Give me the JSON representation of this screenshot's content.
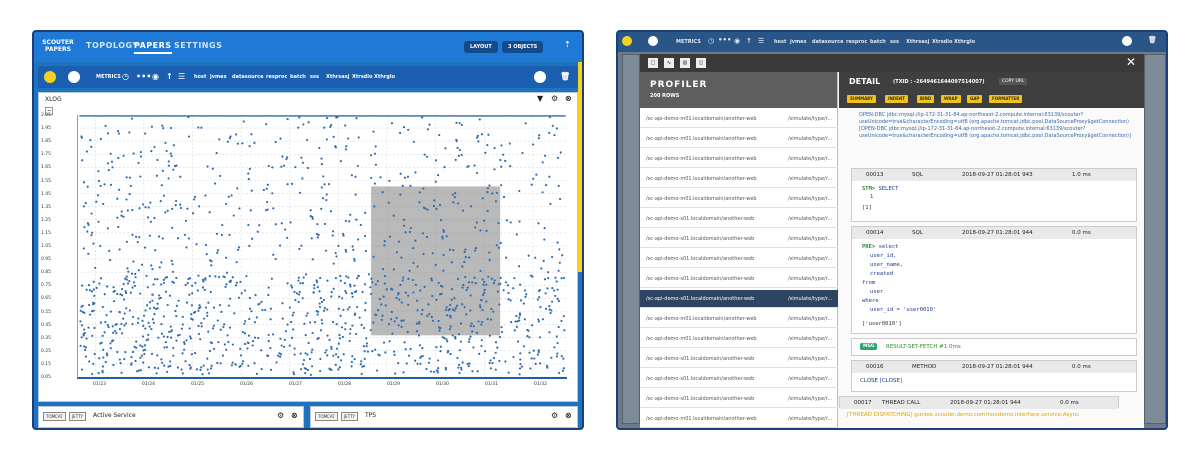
{
  "left": {
    "logo": {
      "line1": "SCOUTER",
      "line2": "PAPERS"
    },
    "nav": [
      {
        "label": "TOPOLOGY"
      },
      {
        "label": "PAPERS"
      },
      {
        "label": "SETTINGS"
      }
    ],
    "layout_btn": "LAYOUT",
    "objects_btn": "3 OBJECTS",
    "toolbar_items": [
      "METRICS",
      "host",
      "jvmes",
      "datasource",
      "resproc",
      "batch",
      "sss",
      "Xthrsasj",
      "Xtrsdlo",
      "Xthrglo"
    ],
    "xlog": {
      "title": "XLOG",
      "yticks": [
        "2.05",
        "1.95",
        "1.85",
        "1.75",
        "1.65",
        "1.55",
        "1.45",
        "1.35",
        "1.25",
        "1.15",
        "1.05",
        "0.95",
        "0.85",
        "0.75",
        "0.65",
        "0.55",
        "0.45",
        "0.35",
        "0.25",
        "0.15",
        "0.05"
      ],
      "xticks": [
        "01/23",
        "01/24",
        "01/25",
        "01/26",
        "01/27",
        "01/28",
        "01/29",
        "01/30",
        "01/31",
        "01/32"
      ]
    },
    "bottom_panels": [
      {
        "chips": [
          "TOMCAT",
          "JETTY"
        ],
        "title": "Active Service"
      },
      {
        "chips": [
          "TOMCAT",
          "JETTY"
        ],
        "title": "TPS"
      }
    ],
    "colors": {
      "accent": "#1e7ad6",
      "dots": "#2c6cb0",
      "highlight": "#f4d21e"
    }
  },
  "right": {
    "toolbar_items": [
      "METRICS",
      "host",
      "jvmes",
      "datasource",
      "resproc",
      "batch",
      "sss",
      "Xthrsasj",
      "Xtrsdlo",
      "Xthrglo"
    ],
    "profiler": {
      "title": "PROFILER",
      "rows_label": "200 ROWS",
      "rows": [
        {
          "path": "/sc-api-demo-m01.localdomain/another-web",
          "uri": "/simulate/type/r...",
          "user": "gunlee.scouter.d..."
        },
        {
          "path": "/sc-api-demo-m01.localdomain/another-web",
          "uri": "/simulate/type/r...",
          "user": "gunlee.scouter.d..."
        },
        {
          "path": "/sc-api-demo-m01.localdomain/another-web",
          "uri": "/simulate/type/r...",
          "user": "gunlee.scouter.d..."
        },
        {
          "path": "/sc-api-demo-m01.localdomain/another-web",
          "uri": "/simulate/type/r...",
          "user": "gunlee.scouter.d..."
        },
        {
          "path": "/sc-api-demo-m01.localdomain/another-web",
          "uri": "/simulate/type/r...",
          "user": "gunlee.scouter.d..."
        },
        {
          "path": "/sc-api-demo-s01.localdomain/another-web",
          "uri": "/simulate/type/r...",
          "user": "gunlee.scouter.d..."
        },
        {
          "path": "/sc-api-demo-s01.localdomain/another-web",
          "uri": "/simulate/type/r...",
          "user": "gunlee.scouter.d..."
        },
        {
          "path": "/sc-api-demo-s01.localdomain/another-web",
          "uri": "/simulate/type/r...",
          "user": "gunlee.scouter.d..."
        },
        {
          "path": "/sc-api-demo-s01.localdomain/another-web",
          "uri": "/simulate/type/r...",
          "user": "gunlee.scouter.d..."
        },
        {
          "path": "/sc-api-demo-s01.localdomain/another-web",
          "uri": "/simulate/type/r...",
          "user": "gunlee.scouter.d..."
        },
        {
          "path": "/sc-api-demo-m01.localdomain/another-web",
          "uri": "/simulate/type/r...",
          "user": "gunlee.scouter.d..."
        },
        {
          "path": "/sc-api-demo-m01.localdomain/another-web",
          "uri": "/simulate/type/r...",
          "user": "gunlee.scouter.d..."
        },
        {
          "path": "/sc-api-demo-s01.localdomain/another-web",
          "uri": "/simulate/type/r...",
          "user": "gunlee.scouter.d..."
        },
        {
          "path": "/sc-api-demo-s01.localdomain/another-web",
          "uri": "/simulate/type/r...",
          "user": "gunlee.scouter.d..."
        },
        {
          "path": "/sc-api-demo-s01.localdomain/another-web",
          "uri": "/simulate/type/r...",
          "user": "gunlee.scouter.d..."
        },
        {
          "path": "/sc-api-demo-m01.localdomain/another-web",
          "uri": "/simulate/type/r...",
          "user": "gunlee.scouter.d..."
        }
      ],
      "selected_index": 9
    },
    "detail": {
      "title": "DETAIL",
      "txid": "(TXID : -2649461644097514007)",
      "copy": "COPY URL",
      "buttons": [
        "SUMMARY",
        "INDENT",
        "BIND",
        "WRAP",
        "GAP",
        "FORMATTER"
      ],
      "jdbc1": "OPEN-DBC jdbc:mysql://ip-172-31-31-84.ap-northeast-2.compute.internal:63139/scouter?useUnicode=true&characterEncoding=utf8 (org.apache.tomcat.jdbc.pool.DataSourceProxy$getConnection) [OPEN-DBC jdbc:mysql://ip-172-31-31-84.ap-northeast-2.compute.internal:63139/scouter?useUnicode=true&characterEncoding=utf8 (org.apache.tomcat.jdbc.pool.DataSourceProxy$getConnection)]",
      "steps": [
        {
          "id": "00013",
          "type": "SQL",
          "time": "2018-09-27 01:28:01 943",
          "elapsed": "1.0 ms",
          "stm": "STM>",
          "sql": [
            "SELECT",
            "1"
          ],
          "param": "[1]"
        },
        {
          "id": "00014",
          "type": "SQL",
          "time": "2018-09-27 01:28:01 944",
          "elapsed": "0.0 ms",
          "stm": "PRE>",
          "sql": [
            "select",
            "user_id,",
            "user_name,",
            "created",
            "from",
            "user",
            "where",
            "user_id = 'user0010'"
          ],
          "param": "['user0010']"
        }
      ],
      "msg_tag": "MSG",
      "msg_text": "RESULT-SET-FETCH #1 0ms",
      "step16": {
        "id": "00016",
        "type": "METHOD",
        "time": "2018-09-27 01:28:01 944",
        "elapsed": "0.0 ms",
        "text": "CLOSE [CLOSE]"
      },
      "step17": {
        "id": "00017",
        "type": "THREAD CALL",
        "time": "2018-09-27 01:28:01 944",
        "elapsed": "0.0 ms"
      },
      "dispatch": "[THREAD DISPATCHING] gunlee.scouter.demo.commondemo.interface.service.Async"
    }
  }
}
